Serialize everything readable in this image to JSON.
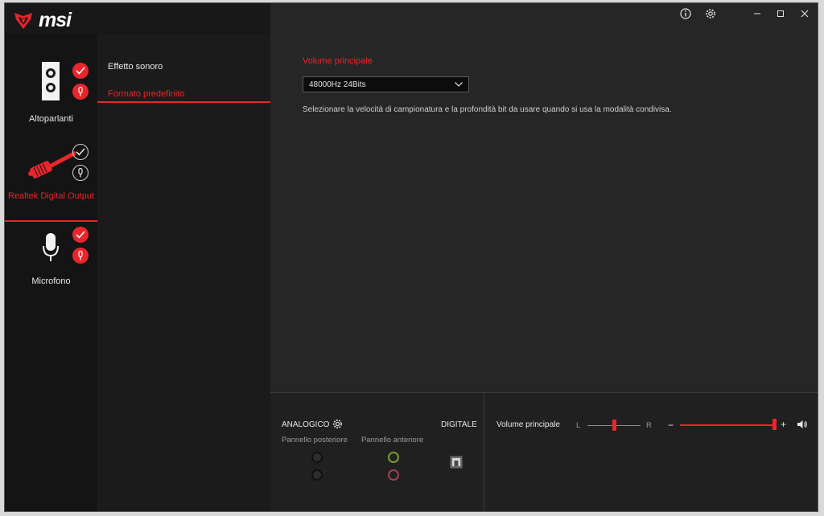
{
  "app": {
    "logo_text": "msi"
  },
  "titlebar": {
    "info_icon": "info-icon",
    "settings_icon": "gear-icon"
  },
  "devices": [
    {
      "label": "Altoparlanti",
      "icon": "speaker-icon",
      "default_device": true,
      "default_comm": true
    },
    {
      "label": "Realtek Digital Output",
      "icon": "cable-icon",
      "default_device": false,
      "default_comm": false
    },
    {
      "label": "Microfono",
      "icon": "microphone-icon",
      "default_device": true,
      "default_comm": true
    }
  ],
  "menu": {
    "items": [
      {
        "label": "Effetto sonoro"
      },
      {
        "label": "Formato predefinito"
      }
    ]
  },
  "main": {
    "section_title": "Volume principale",
    "format_value": "48000Hz 24Bits",
    "description": "Selezionare la velocità di campionatura e la profondità bit da usare quando si usa la modalità condivisa."
  },
  "bottom": {
    "analog_label": "ANALOGICO",
    "digital_label": "DIGITALE",
    "rear_panel_label": "Pannello posteriore",
    "front_panel_label": "Pannello anteriore",
    "volume_label": "Volume principale",
    "balance_left": "L",
    "balance_right": "R",
    "volume_minus": "−",
    "volume_plus": "+",
    "balance_position": 0.5,
    "volume_level": 1.0
  },
  "colors": {
    "accent": "#e8262b",
    "front_green": "#7a9a3a",
    "front_pink": "#a0405a"
  }
}
